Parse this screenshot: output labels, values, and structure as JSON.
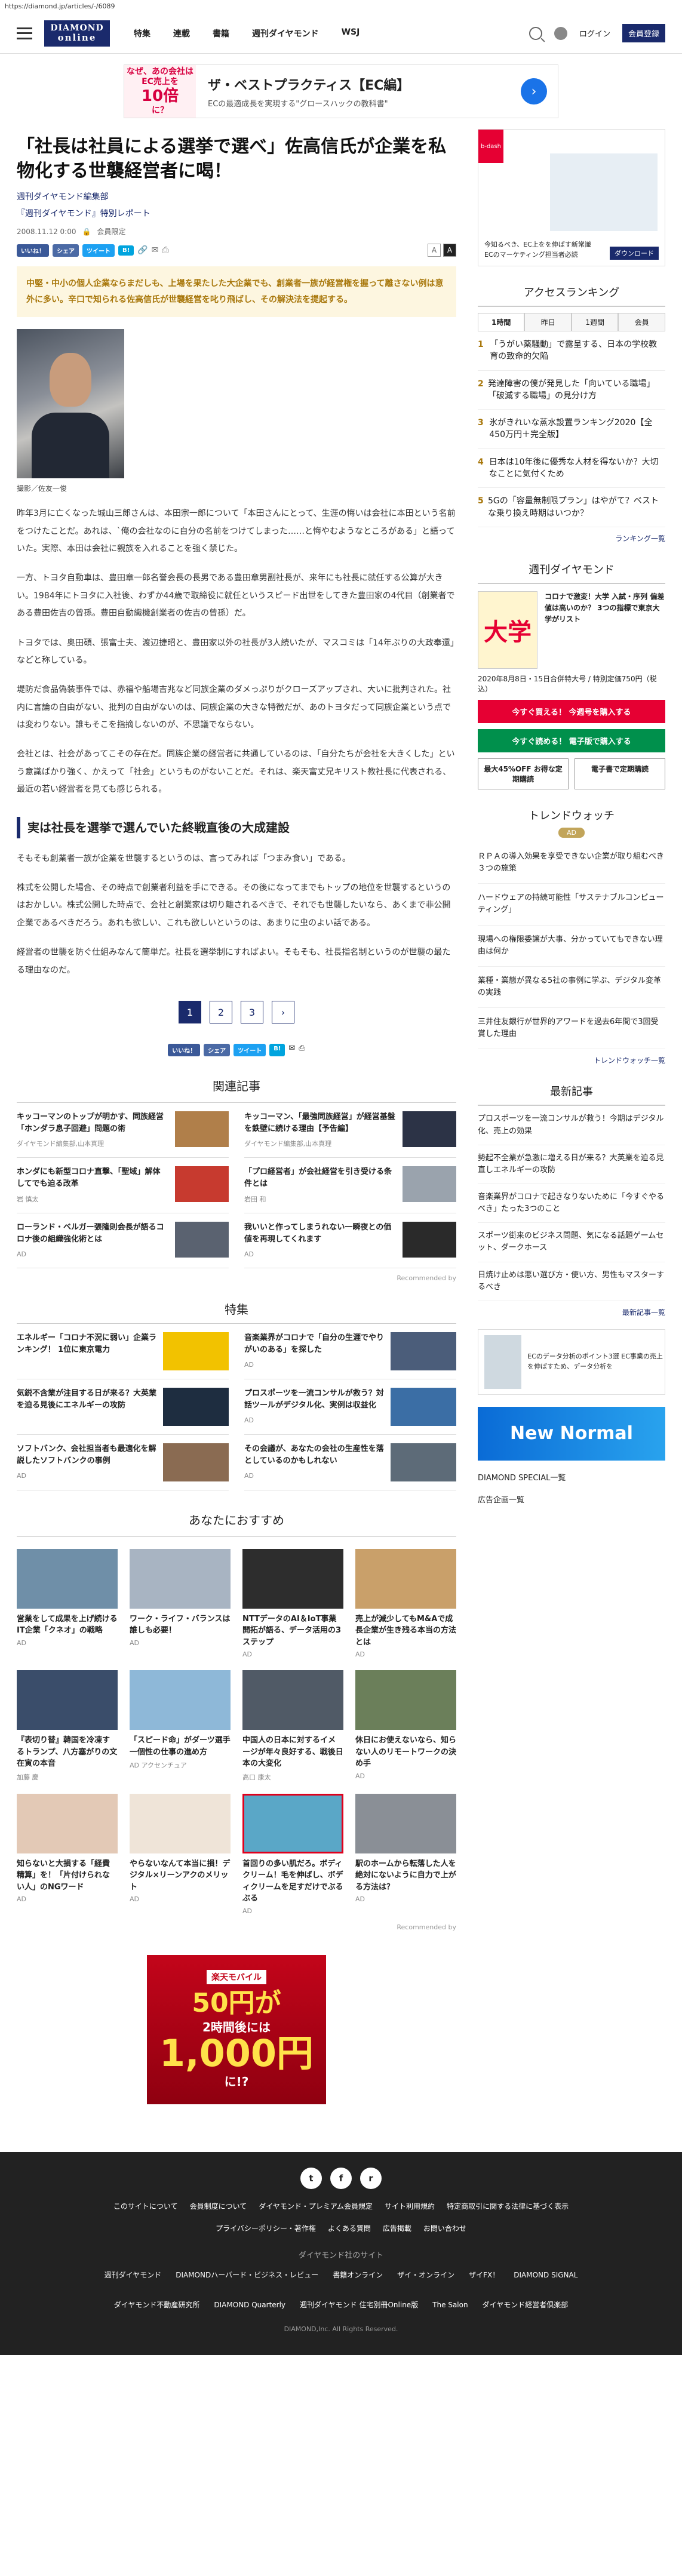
{
  "url": "https://diamond.jp/articles/-/6089",
  "header": {
    "logo_line1": "DIAMOND",
    "logo_line2": "online",
    "nav": [
      "特集",
      "連載",
      "書籍",
      "週刊ダイヤモンド",
      "WSJ"
    ],
    "login": "ログイン",
    "register": "会員登録"
  },
  "top_ad": {
    "box": [
      "なぜ、あの会社は",
      "EC売上を",
      "10倍",
      "に？"
    ],
    "title": "ザ・ベストプラクティス【EC編】",
    "sub": "ECの最適成長を実現する\"グロースハックの教科書\""
  },
  "article": {
    "title": "「社長は社員による選挙で選べ」佐高信氏が企業を私物化する世襲経営者に喝！",
    "series": "週刊ダイヤモンド編集部",
    "series2": "『週刊ダイヤモンド』特別レポート",
    "date": "2008.11.12 0:00",
    "member": "会員限定",
    "lead": "中堅・中小の個人企業ならまだしも、上場を果たした大企業でも、創業者一族が経営権を握って離さない例は意外に多い。辛口で知られる佐高信氏が世襲経営を叱り飛ばし、その解決法を提起する。",
    "caption": "撮影／佐友一俊",
    "paragraphs": [
      "昨年3月に亡くなった城山三郎さんは、本田宗一郎について「本田さんにとって、生涯の悔いは会社に本田という名前をつけたことだ。あれは、`俺の会社なのに自分の名前をつけてしまった……と悔やむようなところがある」と語っていた。実際、本田は会社に親族を入れることを強く禁じた。",
      "一方、トヨタ自動車は、豊田章一郎名誉会長の長男である豊田章男副社長が、来年にも社長に就任する公算が大きい。1984年にトヨタに入社後、わずか44歳で取締役に就任というスピード出世をしてきた豊田家の4代目（創業者である豊田佐吉の曾孫。豊田自動織機創業者の佐吉の曾孫）だ。",
      "トヨタでは、奥田碩、張富士夫、渡辺捷昭と、豊田家以外の社長が3人続いたが、マスコミは「14年ぶりの大政奉還」などと称している。",
      "堤防だ食品偽装事件では、赤福や船場吉兆など同族企業のダメっぷりがクローズアップされ、大いに批判された。社内に言論の自由がない、批判の自由がないのは、同族企業の大きな特徴だが、あのトヨタだって同族企業という点では変わりない。誰もそこを指摘しないのが、不思議でならない。",
      "会社とは、社会があってこその存在だ。同族企業の経営者に共通しているのは、「自分たちが会社を大きくした」という意識ばかり強く、かえって「社会」というものがないことだ。それは、楽天富丈兄キリスト教社長に代表される、最近の若い経営者を見ても感じられる。"
    ],
    "h2": "実は社長を選挙で選んでいた終戦直後の大成建設",
    "paragraphs2": [
      "そもそも創業者一族が企業を世襲するというのは、言ってみれば「つまみ食い」である。",
      "株式を公開した場合、その時点で創業者利益を手にできる。その後になってまでもトップの地位を世襲するというのはおかしい。株式公開した時点で、会社と創業家は切り離されるべきで、それでも世襲したいなら、あくまで非公開企業であるべきだろう。あれも欲しい、これも欲しいというのは、あまりに虫のよい話である。",
      "経営者の世襲を防ぐ仕組みなんて簡単だ。社長を選挙制にすればよい。そもそも、社長指名制というのが世襲の最たる理由なのだ。"
    ],
    "pages": [
      "1",
      "2",
      "3",
      "›"
    ]
  },
  "share": {
    "like": "いいね！",
    "share": "シェア",
    "tweet": "ツイート",
    "hatena": "B!",
    "fs_small": "A",
    "fs_large": "A"
  },
  "related": {
    "heading": "関連記事",
    "items": [
      {
        "title": "キッコーマンのトップが明かす、同族経営「ホンダラ息子回避」問題の術",
        "source": "ダイヤモンド編集部,山本真理"
      },
      {
        "title": "キッコーマン、「最強同族経営」が経営基盤を鉄壁に続ける理由【予告編】",
        "source": "ダイヤモンド編集部,山本真理"
      },
      {
        "title": "ホンダにも新型コロナ直撃、「聖域」解体してでも迫る改革",
        "source": "岩 慎太"
      },
      {
        "title": "「プロ経営者」が会社経営を引き受ける条件とは",
        "source": "岩田 和"
      },
      {
        "title": "ローランド・ベルガー張隆則会長が語るコロナ後の組織強化術とは",
        "source": "AD"
      },
      {
        "title": "我いいと作ってしまうれない一瞬夜との価値を再現してくれます",
        "source": "AD"
      }
    ],
    "recommended_by": "Recommended by"
  },
  "features": {
    "heading": "特集",
    "items": [
      {
        "title": "エネルギー「コロナ不況に弱い」企業ランキング！ 1位に東京電力",
        "tag": ""
      },
      {
        "title": "音楽業界がコロナで「自分の生涯でやりがいのある」を探した",
        "tag": "AD"
      },
      {
        "title": "気鋭不含業が注目する日が来る？大英業を迫る見後にエネルギーの攻防",
        "tag": ""
      },
      {
        "title": "プロスポーツを一流コンサルが救う？対話ツールがデジタル化、実例は収益化",
        "tag": "AD"
      },
      {
        "title": "ソフトバンク、会社担当者も最適化を解説したソフトバンクの事例",
        "tag": "AD"
      },
      {
        "title": "その会議が、あなたの会社の生産性を落としているのかもしれない",
        "tag": "AD"
      }
    ]
  },
  "osusume": {
    "heading": "あなたにおすすめ",
    "items": [
      {
        "title": "営業をして成果を上げ続けるIT企業「クネオ」の戦略",
        "source": "AD"
      },
      {
        "title": "ワーク・ライフ・バランスは誰しも必要！",
        "source": "AD"
      },
      {
        "title": "NTTデータのAI＆IoT事業開拓が語る、データ活用の3ステップ",
        "source": "AD"
      },
      {
        "title": "売上が減少してもM&Aで成長企業が生き残る本当の方法とは",
        "source": "AD"
      },
      {
        "title": "『表切り替』韓国を冷凍するトランプ、八方塞がりの文在寅の本音",
        "source": "加藤 慶"
      },
      {
        "title": "「スピード命」がダーツ選手一個性の仕事の進め方",
        "source": "AD アクセンチュア"
      },
      {
        "title": "中国人の日本に対するイメージが年々良好する、戦後日本の大変化",
        "source": "高口 康太"
      },
      {
        "title": "休日にお使えないなら、知らない人のリモートワークの決め手",
        "source": "AD"
      },
      {
        "title": "知らないと大損する「経費精算」を！「片付けられない人」のNGワード",
        "source": "AD"
      },
      {
        "title": "やらないなんて本当に損！デジタル×リーンアクのメリット",
        "source": "AD"
      },
      {
        "title": "首回りの多い肌だろ。ボディクリーム！毛を伸ばし、ボディクリームを足すだけでぶるぶる",
        "source": "AD"
      },
      {
        "title": "駅のホームから転落した人を絶対にないように自力で上がる方法は？",
        "source": "AD"
      }
    ],
    "recommended_by": "Recommended by"
  },
  "bigad": {
    "a1": "楽天モバイル",
    "a2": "50円が",
    "a3": "2時間後には",
    "a4": "1,000円",
    "a5": "に!?"
  },
  "sidebar": {
    "ad_text1": "今知るべき、EC上をを伸ばす新常識",
    "ad_text2": "ECのマーケティング担当者必読",
    "ad_download": "ダウンロード",
    "ad_brand": "b-dash",
    "ranking_heading": "アクセスランキング",
    "tabs": [
      "1時間",
      "昨日",
      "1週間",
      "会員"
    ],
    "rankings": [
      "「うがい薬騒動」で露呈する、日本の学校教育の致命的欠陥",
      "発達障害の僕が発見した「向いている職場」「破滅する職場」の見分け方",
      "氷がきれいな蒸水設置ランキング2020【全450万円＋完全版】",
      "日本は10年後に優秀な人材を得ないか？大切なことに気付くため",
      "5Gの「容量無制限プラン」はやがて？ベストな乗り換え時期はいつか？"
    ],
    "ranking_more": "ランキング一覧",
    "mag_heading": "週刊ダイヤモンド",
    "mag_cover": "大学",
    "mag_title": "コロナで激変！大学 入試・序列 偏差値は高いのか？ 3つの指標で東京大学がリスト",
    "mag_date": "2020年8月8日・15日合併特大号 / 特別定価750円（税込）",
    "mag_btn_buy": "今すぐ買える！ 今週号を購入する",
    "mag_btn_dig": "今すぐ読める！ 電子版で購入する",
    "mag_btn_sub1": "最大45%OFF お得な定期購読",
    "mag_btn_sub2": "電子書で定期購読",
    "trend_heading": "トレンドウォッチ",
    "trend_badge": "AD",
    "trends": [
      "ＲＰＡの導入効果を享受できない企業が取り組むべき３つの施策",
      "ハードウェアの持続可能性「サステナブルコンピューティング」",
      "現場への権限委譲が大事、分かっていてもできない理由は何か",
      "業種・業態が異なる5社の事例に学ぶ、デジタル変革の実践",
      "三井住友銀行が世界的アワードを過去6年間で3回受賞した理由"
    ],
    "trend_more": "トレンドウォッチ一覧",
    "new_heading": "最新記事",
    "newest": [
      "プロスポーツを一流コンサルが救う！今期はデジタル化、売上の効果",
      "勢起不全業が急激に増える日が来る？大英業を迫る見直しエネルギーの攻防",
      "音楽業界がコロナで起きなりないために「今すぐやるべき」たった3つのこと",
      "スポーツ街来のビジネス問題、気になる話題ゲームセット、ダークホース",
      "日焼け止めは悪い選び方・使い方、男性もマスターするべき"
    ],
    "new_more": "最新記事一覧",
    "ad2_text": "ECのデータ分析のポイント3選 EC事業の売上を伸ばすため、データ分析を",
    "newnormal": "New Normal",
    "special": "DIAMOND SPECIAL一覧",
    "ad_list": "広告企画一覧"
  },
  "footer": {
    "icons": [
      "t",
      "f",
      "r"
    ],
    "links": [
      "このサイトについて",
      "会員制度について",
      "ダイヤモンド・プレミアム会員規定",
      "サイト利用規約",
      "特定商取引に関する法律に基づく表示",
      "プライバシーポリシー・著作権",
      "よくある質問",
      "広告掲載",
      "お問い合わせ"
    ],
    "sites_heading": "ダイヤモンド社のサイト",
    "sites": [
      "週刊ダイヤモンド",
      "DIAMONDハーバード・ビジネス・レビュー",
      "書籍オンライン",
      "ザイ・オンライン",
      "ザイFX！",
      "DIAMOND SIGNAL",
      "ダイヤモンド不動産研究所",
      "DIAMOND Quarterly",
      "週刊ダイヤモンド 住宅別冊Online版",
      "The Salon",
      "ダイヤモンド経営者倶楽部"
    ],
    "copyright": "DIAMOND,Inc. All Rights Reserved."
  },
  "colors": {
    "brand": "#1a2a6c",
    "accent_gold": "#a8770b",
    "red": "#e60033",
    "green": "#00904c"
  }
}
